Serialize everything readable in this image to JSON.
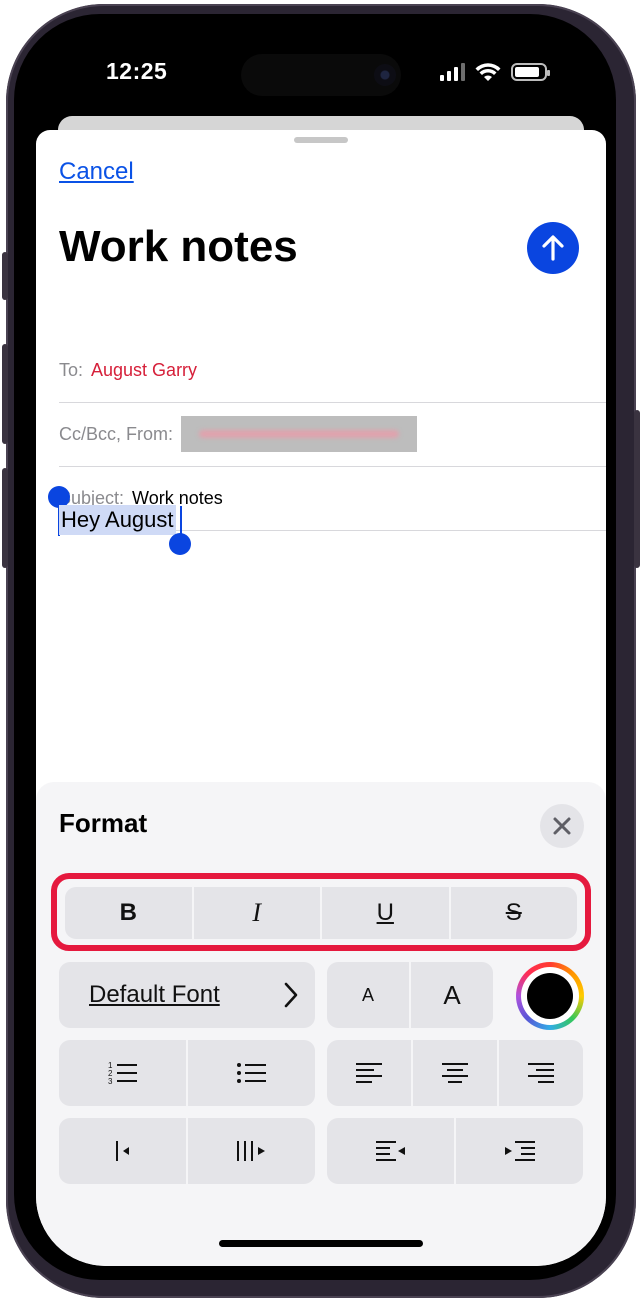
{
  "status_bar": {
    "time": "12:25"
  },
  "compose": {
    "cancel_label": "Cancel",
    "title": "Work notes",
    "to_label": "To:",
    "to_value": "August Garry",
    "ccbcc_label": "Cc/Bcc, From:",
    "subject_label": "Subject:",
    "subject_value": "Work notes",
    "body_text": "Hey August"
  },
  "format": {
    "title": "Format",
    "style_buttons": [
      {
        "label": "B"
      },
      {
        "label": "I"
      },
      {
        "label": "U"
      },
      {
        "label": "S"
      }
    ],
    "font_label": "Default Font",
    "size_small_label": "A",
    "size_large_label": "A",
    "text_color": "#000000"
  },
  "colors": {
    "accent": "#0a45e0",
    "highlight_outline": "#e5193e",
    "recipient": "#d6203a"
  },
  "icons": {
    "send": "arrow-up-icon",
    "close": "xmark-icon",
    "chevron": "chevron-right-icon",
    "numbered_list": "numbered-list-icon",
    "bullet_list": "bullet-list-icon",
    "align_left": "align-left-icon",
    "align_center": "align-center-icon",
    "align_right": "align-right-icon",
    "indent_decrease": "indent-decrease-icon",
    "indent_increase": "indent-increase-icon",
    "quote_decrease": "quote-decrease-icon",
    "quote_increase": "quote-increase-icon"
  }
}
